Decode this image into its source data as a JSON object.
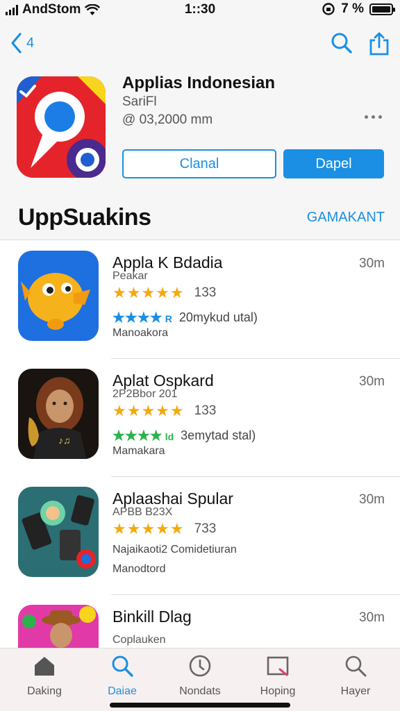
{
  "status_bar": {
    "carrier": "AndStom",
    "time": "1::30",
    "right_text": "7 %"
  },
  "nav": {
    "back_label": "4"
  },
  "hero": {
    "title": "Applias Indonesian",
    "subtitle": "SariFl",
    "meta": "@ 03,2000 mm",
    "button_secondary": "Clanal",
    "button_primary": "Dapel"
  },
  "section": {
    "title": "UppSuakins",
    "link": "GAMAKANT"
  },
  "apps": [
    {
      "title": "Appla K Bdadia",
      "time": "30m",
      "sub": "Peakar",
      "rating_count": "133",
      "extra": "20mykud utal)",
      "developer": "Manoakora",
      "rating2_color": "#1a8fe3",
      "rating2_stars": "★★★★",
      "rating2_tail": "R"
    },
    {
      "title": "Aplat Ospkard",
      "time": "30m",
      "sub": "2P2Bbor 201",
      "rating_count": "133",
      "extra": "3emytad stal)",
      "developer": "Mamakara",
      "rating2_color": "#2bb24c",
      "rating2_stars": "★★★★",
      "rating2_tail": "ld"
    },
    {
      "title": "Aplaashai Spular",
      "time": "30m",
      "sub": "APBB B23X",
      "rating_count": "733",
      "extra": "Najaikaoti2  Comidetiuran",
      "developer": "Manodtord",
      "rating2_color": "",
      "rating2_stars": "",
      "rating2_tail": ""
    },
    {
      "title": "Binkill Dlag",
      "time": "30m",
      "sub": "Coplauken",
      "rating_count": "",
      "extra": "",
      "developer": "",
      "rating2_color": "",
      "rating2_stars": "",
      "rating2_tail": ""
    }
  ],
  "tabs": [
    {
      "label": "Daking",
      "icon": "home-icon"
    },
    {
      "label": "Daiae",
      "icon": "search-icon"
    },
    {
      "label": "Nondats",
      "icon": "clock-icon"
    },
    {
      "label": "Hoping",
      "icon": "inbox-icon"
    },
    {
      "label": "Hayer",
      "icon": "search-icon"
    }
  ],
  "colors": {
    "accent": "#1a8fe3",
    "star": "#f4a90f",
    "icon_red": "#e5232a"
  }
}
